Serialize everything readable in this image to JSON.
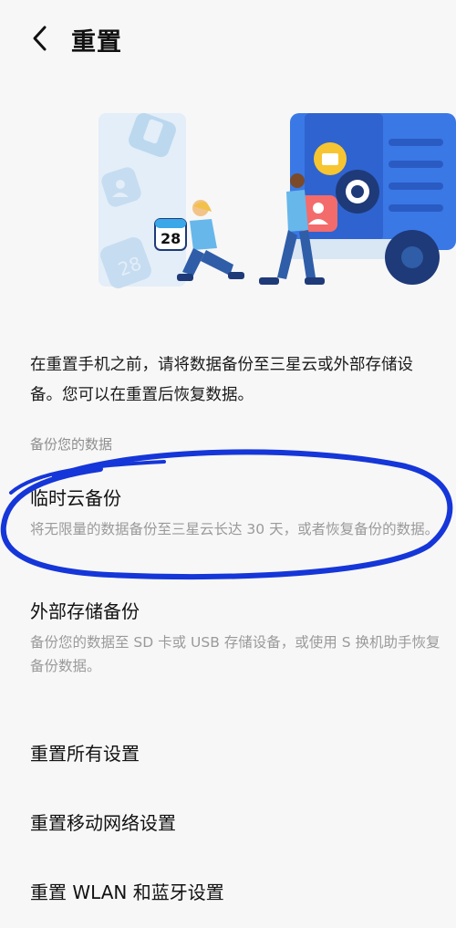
{
  "header": {
    "title": "重置"
  },
  "illustration": {
    "calendar_number": "28",
    "calendar_number_faded": "28"
  },
  "intro_text": "在重置手机之前，请将数据备份至三星云或外部存储设备。您可以在重置后恢复数据。",
  "section_label": "备份您的数据",
  "backup_items": [
    {
      "title": "临时云备份",
      "subtitle": "将无限量的数据备份至三星云长达 30 天，或者恢复备份的数据。"
    },
    {
      "title": "外部存储备份",
      "subtitle": "备份您的数据至 SD 卡或 USB 存储设备，或使用 S 换机助手恢复备份数据。"
    }
  ],
  "reset_items": [
    {
      "label": "重置所有设置"
    },
    {
      "label": "重置移动网络设置"
    },
    {
      "label": "重置 WLAN 和蓝牙设置"
    }
  ],
  "colors": {
    "accent_blue": "#3a78e6",
    "light_blue": "#cfe4f7",
    "navy": "#1f3a78",
    "annotation_blue": "#1536d8"
  }
}
